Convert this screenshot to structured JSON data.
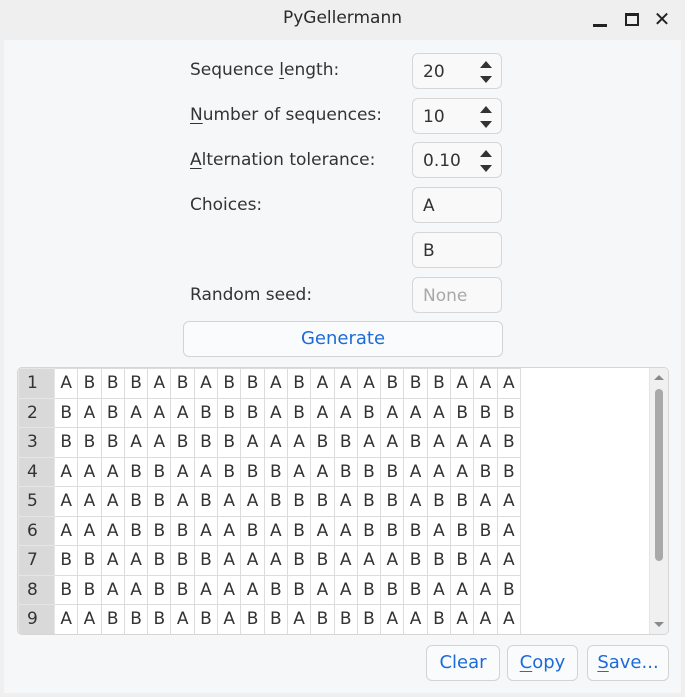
{
  "window": {
    "title": "PyGellermann",
    "controls": {
      "minimize": "minimize",
      "maximize": "maximize",
      "close": "✕"
    }
  },
  "form": {
    "sequence_length": {
      "label_pre": "Sequence ",
      "label_mnemonic": "l",
      "label_post": "ength:",
      "value": "20"
    },
    "number_of_sequences": {
      "label_pre": "",
      "label_mnemonic": "N",
      "label_post": "umber of sequences:",
      "value": "10"
    },
    "alternation_tolerance": {
      "label_pre": "",
      "label_mnemonic": "A",
      "label_post": "lternation tolerance:",
      "value": "0.10"
    },
    "choices": {
      "label": "Choices:",
      "values": [
        "A",
        "B"
      ]
    },
    "random_seed": {
      "label": "Random seed:",
      "value": "",
      "placeholder": "None"
    },
    "generate_label": "Generate"
  },
  "table": {
    "row_headers": [
      "1",
      "2",
      "3",
      "4",
      "5",
      "6",
      "7",
      "8",
      "9"
    ],
    "rows": [
      [
        "A",
        "B",
        "B",
        "B",
        "A",
        "B",
        "A",
        "B",
        "B",
        "A",
        "B",
        "A",
        "A",
        "A",
        "B",
        "B",
        "B",
        "A",
        "A",
        "A"
      ],
      [
        "B",
        "A",
        "B",
        "A",
        "A",
        "A",
        "B",
        "B",
        "B",
        "A",
        "B",
        "A",
        "A",
        "B",
        "A",
        "A",
        "A",
        "B",
        "B",
        "B"
      ],
      [
        "B",
        "B",
        "B",
        "A",
        "A",
        "B",
        "B",
        "B",
        "A",
        "A",
        "A",
        "B",
        "B",
        "A",
        "A",
        "B",
        "A",
        "A",
        "A",
        "B"
      ],
      [
        "A",
        "A",
        "A",
        "B",
        "B",
        "A",
        "A",
        "B",
        "B",
        "B",
        "A",
        "A",
        "B",
        "B",
        "B",
        "A",
        "A",
        "A",
        "B",
        "B"
      ],
      [
        "A",
        "A",
        "A",
        "B",
        "B",
        "A",
        "B",
        "A",
        "A",
        "B",
        "B",
        "B",
        "A",
        "B",
        "B",
        "A",
        "B",
        "B",
        "A",
        "A"
      ],
      [
        "A",
        "A",
        "A",
        "B",
        "B",
        "B",
        "A",
        "A",
        "B",
        "A",
        "B",
        "A",
        "A",
        "B",
        "B",
        "B",
        "A",
        "B",
        "B",
        "A"
      ],
      [
        "B",
        "B",
        "A",
        "A",
        "B",
        "B",
        "B",
        "A",
        "A",
        "A",
        "B",
        "B",
        "A",
        "A",
        "A",
        "B",
        "B",
        "B",
        "A",
        "A"
      ],
      [
        "B",
        "B",
        "A",
        "A",
        "B",
        "B",
        "A",
        "A",
        "A",
        "B",
        "B",
        "A",
        "A",
        "B",
        "B",
        "B",
        "A",
        "A",
        "A",
        "B"
      ],
      [
        "A",
        "A",
        "B",
        "B",
        "B",
        "A",
        "B",
        "A",
        "B",
        "B",
        "A",
        "B",
        "B",
        "B",
        "A",
        "A",
        "B",
        "A",
        "A",
        "A"
      ]
    ]
  },
  "buttons": {
    "clear": {
      "label": "Clear"
    },
    "copy": {
      "mnemonic": "C",
      "rest": "opy"
    },
    "save": {
      "mnemonic": "S",
      "rest": "ave..."
    }
  },
  "colors": {
    "accent": "#1d6bd6",
    "background": "#f6f7f9",
    "row_header": "#d9d9d9"
  }
}
